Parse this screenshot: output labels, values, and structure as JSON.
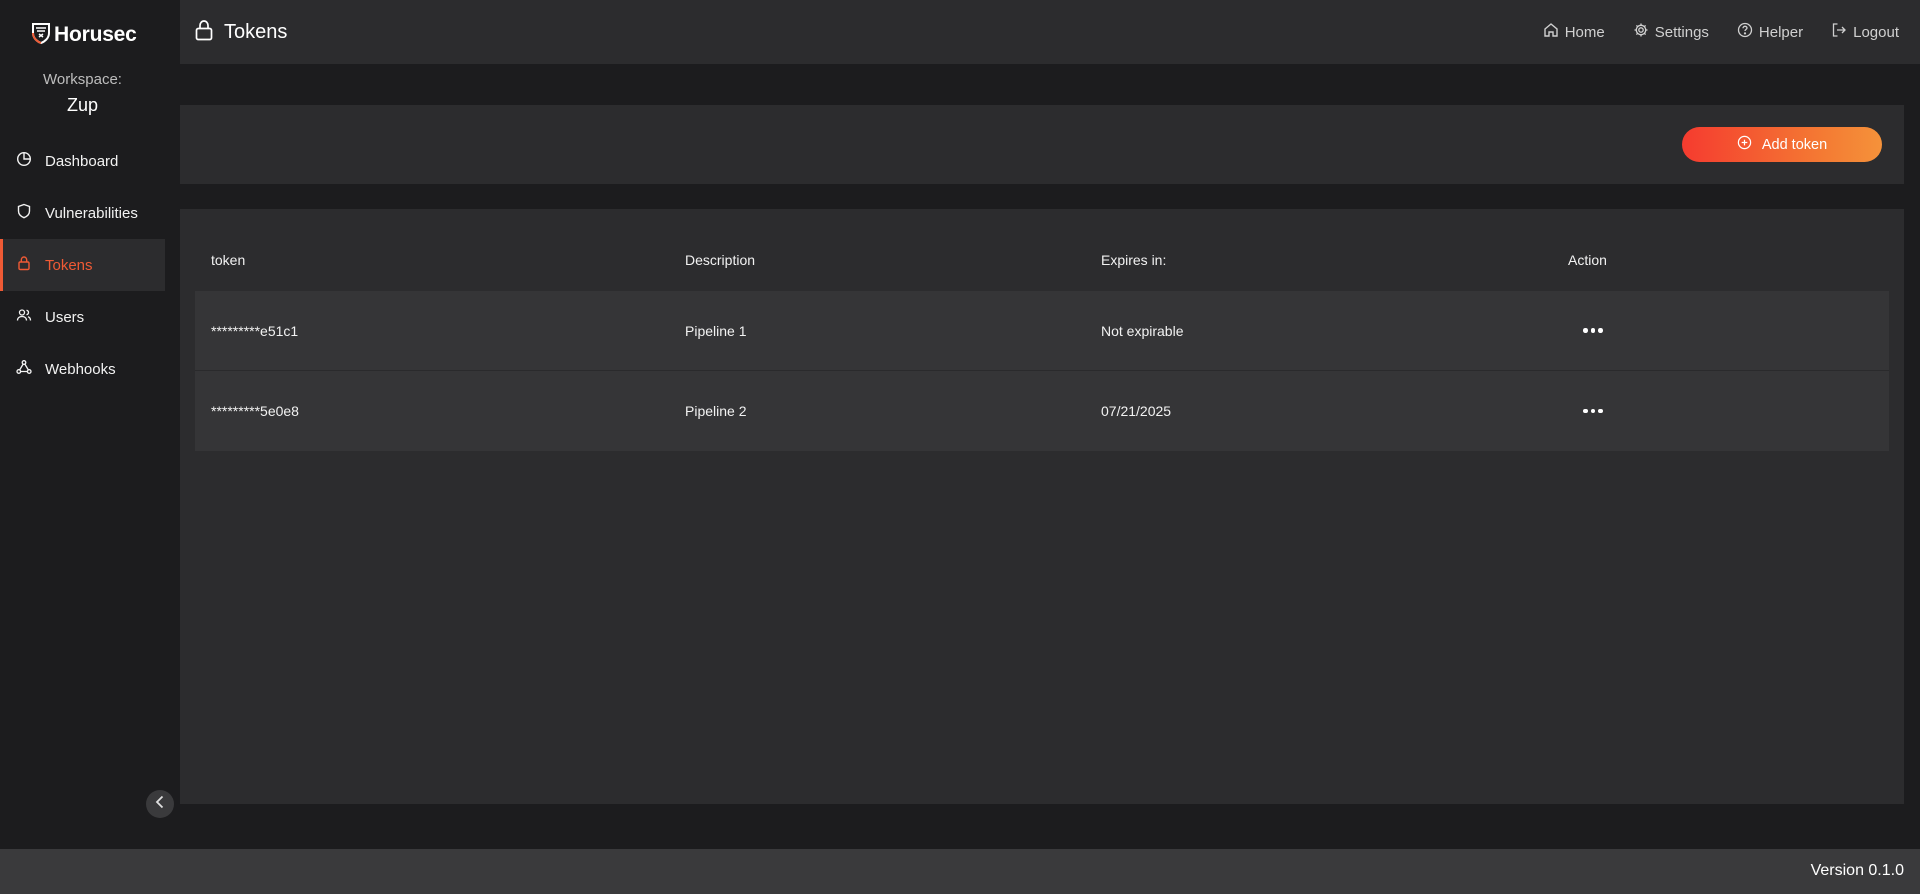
{
  "app": {
    "name": "Horusec"
  },
  "sidebar": {
    "workspace_label": "Workspace:",
    "workspace_name": "Zup",
    "items": [
      {
        "label": "Dashboard",
        "icon": "pie-chart-icon",
        "active": false
      },
      {
        "label": "Vulnerabilities",
        "icon": "shield-icon",
        "active": false
      },
      {
        "label": "Tokens",
        "icon": "lock-icon",
        "active": true
      },
      {
        "label": "Users",
        "icon": "users-icon",
        "active": false
      },
      {
        "label": "Webhooks",
        "icon": "webhook-icon",
        "active": false
      }
    ]
  },
  "header": {
    "title": "Tokens",
    "nav": [
      {
        "label": "Home",
        "icon": "home-icon"
      },
      {
        "label": "Settings",
        "icon": "gear-icon"
      },
      {
        "label": "Helper",
        "icon": "help-icon"
      },
      {
        "label": "Logout",
        "icon": "logout-icon"
      }
    ]
  },
  "toolbar": {
    "add_label": "Add token"
  },
  "table": {
    "columns": [
      "token",
      "Description",
      "Expires in:",
      "Action"
    ],
    "rows": [
      {
        "token": "*********e51c1",
        "description": "Pipeline 1",
        "expires": "Not expirable"
      },
      {
        "token": "*********5e0e8",
        "description": "Pipeline 2",
        "expires": "07/21/2025"
      }
    ]
  },
  "footer": {
    "version": "Version 0.1.0"
  },
  "colors": {
    "accent": "#ef5a35",
    "button_gradient_start": "#f53b2f",
    "button_gradient_end": "#f5923a",
    "background": "#1c1c1e",
    "panel": "#2c2c2e",
    "row": "#353537"
  }
}
